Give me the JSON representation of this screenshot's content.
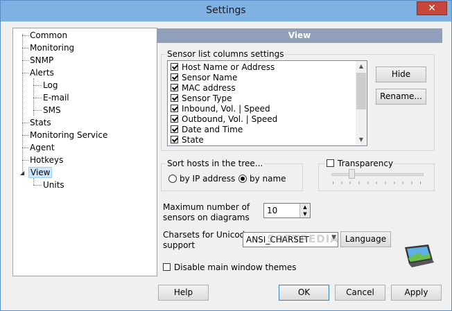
{
  "window": {
    "title": "Settings",
    "close_glyph": "✕"
  },
  "tree": {
    "items": [
      {
        "label": "Common"
      },
      {
        "label": "Monitoring"
      },
      {
        "label": "SNMP"
      },
      {
        "label": "Alerts"
      },
      {
        "label": "Log"
      },
      {
        "label": "E-mail"
      },
      {
        "label": "SMS"
      },
      {
        "label": "Stats"
      },
      {
        "label": "Monitoring Service"
      },
      {
        "label": "Agent"
      },
      {
        "label": "Hotkeys"
      },
      {
        "label": "View"
      },
      {
        "label": "Units"
      }
    ],
    "selected": "View"
  },
  "panel": {
    "title": "View"
  },
  "sensor_columns": {
    "group_label": "Sensor list columns settings",
    "items": [
      {
        "label": "Host Name or Address",
        "checked": true
      },
      {
        "label": "Sensor Name",
        "checked": true
      },
      {
        "label": "MAC address",
        "checked": true
      },
      {
        "label": "Sensor Type",
        "checked": true
      },
      {
        "label": "Inbound, Vol. | Speed",
        "checked": true
      },
      {
        "label": "Outbound, Vol. | Speed",
        "checked": true
      },
      {
        "label": "Date and Time",
        "checked": true
      },
      {
        "label": "State",
        "checked": true
      }
    ],
    "hide_label": "Hide",
    "rename_label": "Rename..."
  },
  "sort": {
    "group_label": "Sort hosts in the tree...",
    "by_ip_label": "by IP address",
    "by_name_label": "by name",
    "selected": "by name"
  },
  "transparency": {
    "label": "Transparency",
    "checked": false,
    "level": 0.2
  },
  "max_sensors": {
    "label_line1": "Maximum number of",
    "label_line2": "sensors on diagrams",
    "value": "10"
  },
  "charsets": {
    "label_line1": "Charsets for Unicode",
    "label_line2": "support",
    "value": "ANSI_CHARSET",
    "language_label": "Language"
  },
  "watermark": "SOFTPEDIA",
  "disable_themes": {
    "label": "Disable main window themes",
    "checked": false
  },
  "footer": {
    "help_label": "Help",
    "ok_label": "OK",
    "cancel_label": "Cancel",
    "apply_label": "Apply"
  },
  "icons": {
    "monitor": "monitor-icon",
    "close": "close-icon"
  }
}
